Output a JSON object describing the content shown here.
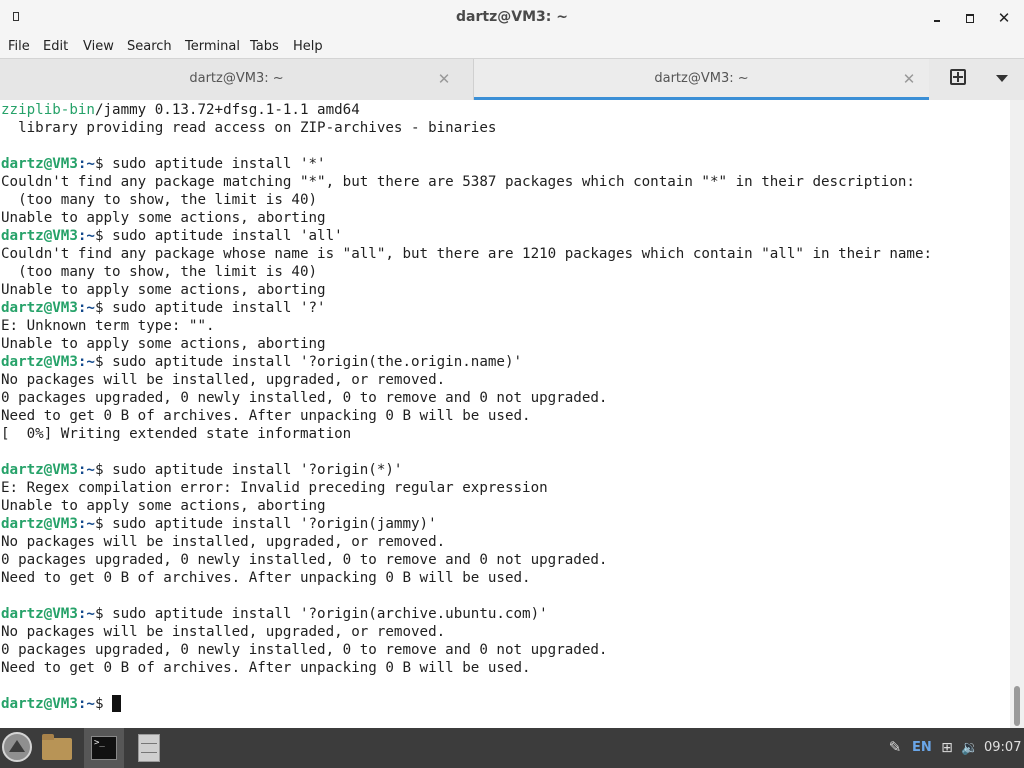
{
  "window": {
    "title": "dartz@VM3: ~",
    "controls": {
      "minimize": "minimize",
      "maximize": "maximize",
      "close": "✕"
    }
  },
  "menubar": {
    "items": [
      {
        "label": "File"
      },
      {
        "label": "Edit"
      },
      {
        "label": "View"
      },
      {
        "label": "Search"
      },
      {
        "label": "Terminal"
      },
      {
        "label": "Tabs"
      },
      {
        "label": "Help"
      }
    ]
  },
  "tabs": [
    {
      "label": "dartz@VM3: ~",
      "close": "✕",
      "active": false
    },
    {
      "label": "dartz@VM3: ~",
      "close": "✕",
      "active": true
    }
  ],
  "terminal": {
    "prompt_user": "dartz@VM3",
    "prompt_path": ":~",
    "prompt_sign": "$ ",
    "lines": [
      {
        "type": "pkg",
        "name": "zziplib-bin",
        "rest": "/jammy 0.13.72+dfsg.1-1.1 amd64"
      },
      {
        "type": "text",
        "text": "  library providing read access on ZIP-archives - binaries"
      },
      {
        "type": "text",
        "text": ""
      },
      {
        "type": "prompt",
        "cmd": "sudo aptitude install '*'"
      },
      {
        "type": "text",
        "text": "Couldn't find any package matching \"*\", but there are 5387 packages which contain \"*\" in their description:"
      },
      {
        "type": "text",
        "text": "  (too many to show, the limit is 40)"
      },
      {
        "type": "text",
        "text": "Unable to apply some actions, aborting"
      },
      {
        "type": "prompt",
        "cmd": "sudo aptitude install 'all'"
      },
      {
        "type": "text",
        "text": "Couldn't find any package whose name is \"all\", but there are 1210 packages which contain \"all\" in their name:"
      },
      {
        "type": "text",
        "text": "  (too many to show, the limit is 40)"
      },
      {
        "type": "text",
        "text": "Unable to apply some actions, aborting"
      },
      {
        "type": "prompt",
        "cmd": "sudo aptitude install '?'"
      },
      {
        "type": "text",
        "text": "E: Unknown term type: \"\"."
      },
      {
        "type": "text",
        "text": "Unable to apply some actions, aborting"
      },
      {
        "type": "prompt",
        "cmd": "sudo aptitude install '?origin(the.origin.name)'"
      },
      {
        "type": "text",
        "text": "No packages will be installed, upgraded, or removed."
      },
      {
        "type": "text",
        "text": "0 packages upgraded, 0 newly installed, 0 to remove and 0 not upgraded."
      },
      {
        "type": "text",
        "text": "Need to get 0 B of archives. After unpacking 0 B will be used."
      },
      {
        "type": "text",
        "text": "[  0%] Writing extended state information"
      },
      {
        "type": "text",
        "text": ""
      },
      {
        "type": "prompt",
        "cmd": "sudo aptitude install '?origin(*)'"
      },
      {
        "type": "text",
        "text": "E: Regex compilation error: Invalid preceding regular expression"
      },
      {
        "type": "text",
        "text": "Unable to apply some actions, aborting"
      },
      {
        "type": "prompt",
        "cmd": "sudo aptitude install '?origin(jammy)'"
      },
      {
        "type": "text",
        "text": "No packages will be installed, upgraded, or removed."
      },
      {
        "type": "text",
        "text": "0 packages upgraded, 0 newly installed, 0 to remove and 0 not upgraded."
      },
      {
        "type": "text",
        "text": "Need to get 0 B of archives. After unpacking 0 B will be used."
      },
      {
        "type": "text",
        "text": ""
      },
      {
        "type": "prompt",
        "cmd": "sudo aptitude install '?origin(archive.ubuntu.com)'"
      },
      {
        "type": "text",
        "text": "No packages will be installed, upgraded, or removed."
      },
      {
        "type": "text",
        "text": "0 packages upgraded, 0 newly installed, 0 to remove and 0 not upgraded."
      },
      {
        "type": "text",
        "text": "Need to get 0 B of archives. After unpacking 0 B will be used."
      },
      {
        "type": "text",
        "text": ""
      },
      {
        "type": "prompt",
        "cmd": "",
        "cursor": true
      }
    ]
  },
  "taskbar": {
    "start_icon": "start-menu-icon",
    "launchers": [
      {
        "icon": "file-manager-icon"
      },
      {
        "icon": "terminal-icon",
        "label": ">_"
      },
      {
        "icon": "file-cabinet-icon"
      }
    ],
    "tray": {
      "note_icon": "notes-icon",
      "language": "EN",
      "network_icon": "network-icon",
      "volume_icon": "volume-icon",
      "clock": "09:07"
    }
  },
  "colors": {
    "prompt_user": "#26a269",
    "prompt_path": "#12488b",
    "active_tab_underline": "#3b8fd6",
    "taskbar": "#3c3c3c"
  }
}
